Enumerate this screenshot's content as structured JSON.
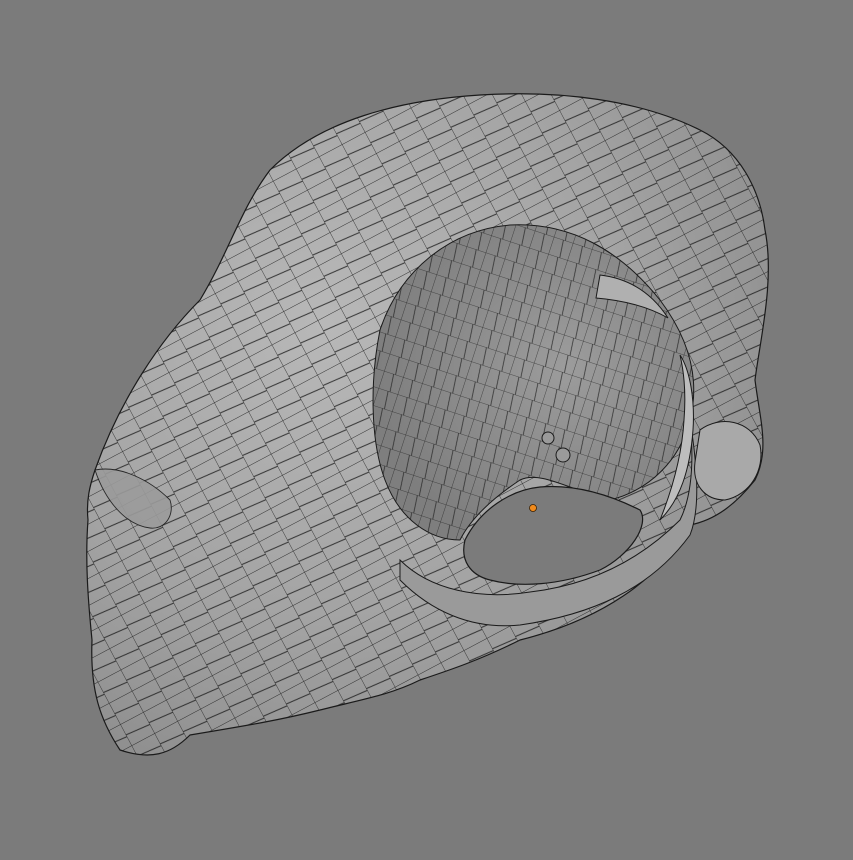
{
  "viewport": {
    "background_color": "#7b7b7b",
    "mesh_fill_color": "#a7a7a7",
    "wire_color": "#1a1a1a",
    "origin_marker_color": "#f08a1c"
  },
  "icons": {
    "origin": "origin-dot-icon"
  }
}
